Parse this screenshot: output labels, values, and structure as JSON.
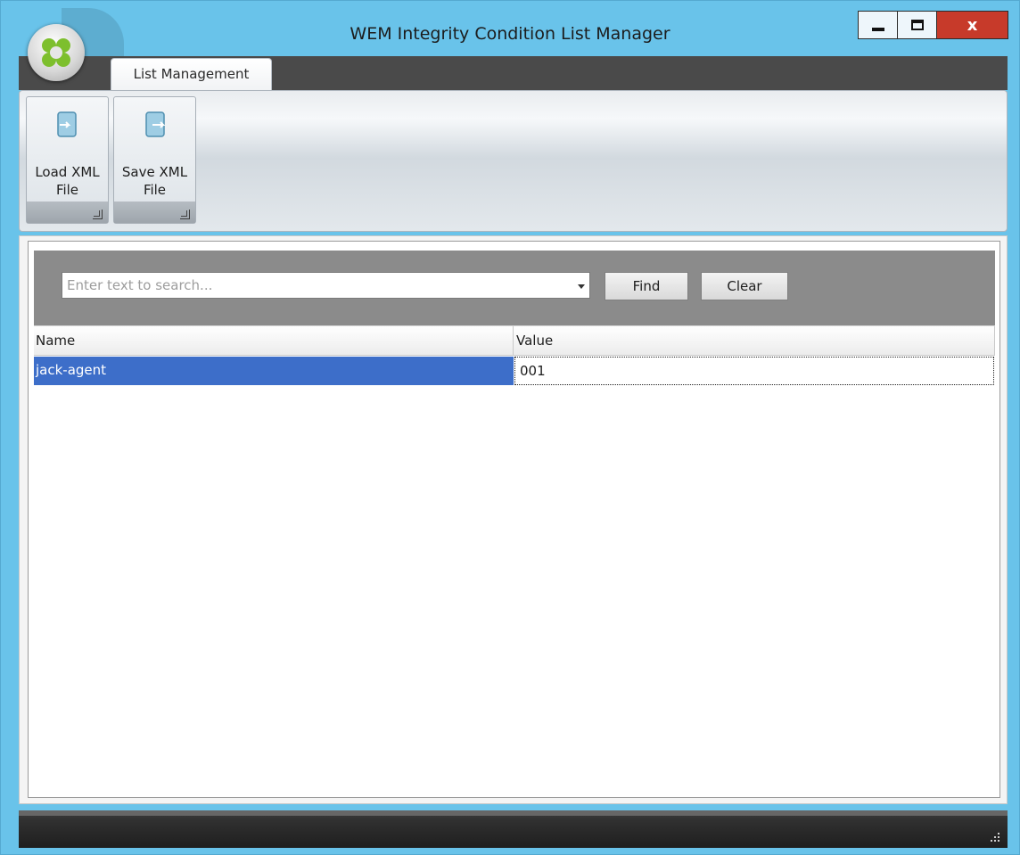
{
  "window": {
    "title": "WEM Integrity Condition List Manager",
    "close_label": "x"
  },
  "ribbon": {
    "tabs": [
      {
        "label": "List Management",
        "active": true
      }
    ],
    "buttons": {
      "load_xml": "Load XML\nFile",
      "save_xml": "Save XML\nFile"
    }
  },
  "search": {
    "placeholder": "Enter text to search...",
    "value": "",
    "find_label": "Find",
    "clear_label": "Clear"
  },
  "grid": {
    "columns": [
      "Name",
      "Value"
    ],
    "rows": [
      {
        "name": "jack-agent",
        "value": "001",
        "selected": true
      }
    ]
  },
  "colors": {
    "window_frame": "#69c3ea",
    "selection": "#3d6ec9",
    "close_button": "#c73a2a",
    "search_panel": "#8b8b8b"
  },
  "icons": [
    "app-orb-icon",
    "minimize-icon",
    "maximize-icon",
    "close-icon",
    "load-xml-icon",
    "save-xml-icon",
    "dropdown-arrow-icon",
    "size-grip-icon",
    "dialog-launcher-icon"
  ]
}
